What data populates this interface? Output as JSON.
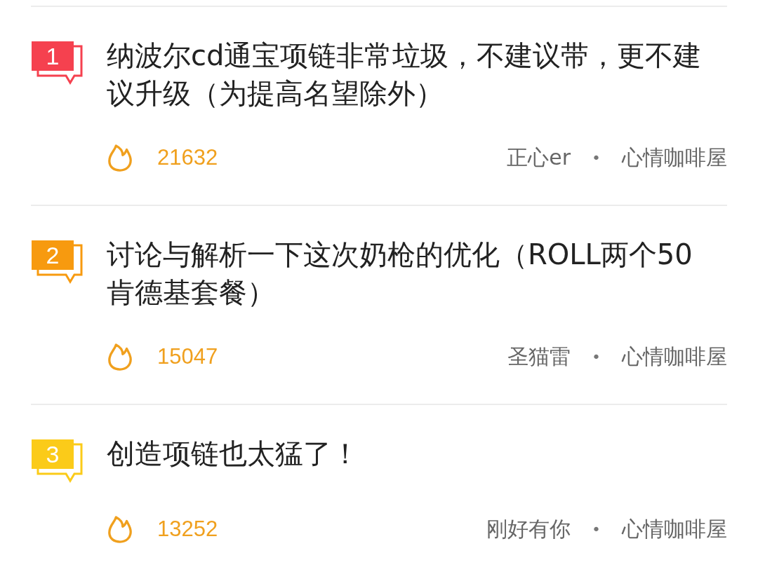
{
  "posts": [
    {
      "rank": "1",
      "color": "#f5414f",
      "title": "纳波尔cd通宝项链非常垃圾，不建议带，更不建议升级（为提高名望除外）",
      "heat": "21632",
      "author": "正心er",
      "separator": "•",
      "board": "心情咖啡屋"
    },
    {
      "rank": "2",
      "color": "#f79a0f",
      "title": "讨论与解析一下这次奶枪的优化（ROLL两个50肯德基套餐）",
      "heat": "15047",
      "author": "圣猫雷",
      "separator": "•",
      "board": "心情咖啡屋"
    },
    {
      "rank": "3",
      "color": "#fbcb19",
      "title": "创造项链也太猛了！",
      "heat": "13252",
      "author": "刚好有你",
      "separator": "•",
      "board": "心情咖啡屋"
    }
  ]
}
